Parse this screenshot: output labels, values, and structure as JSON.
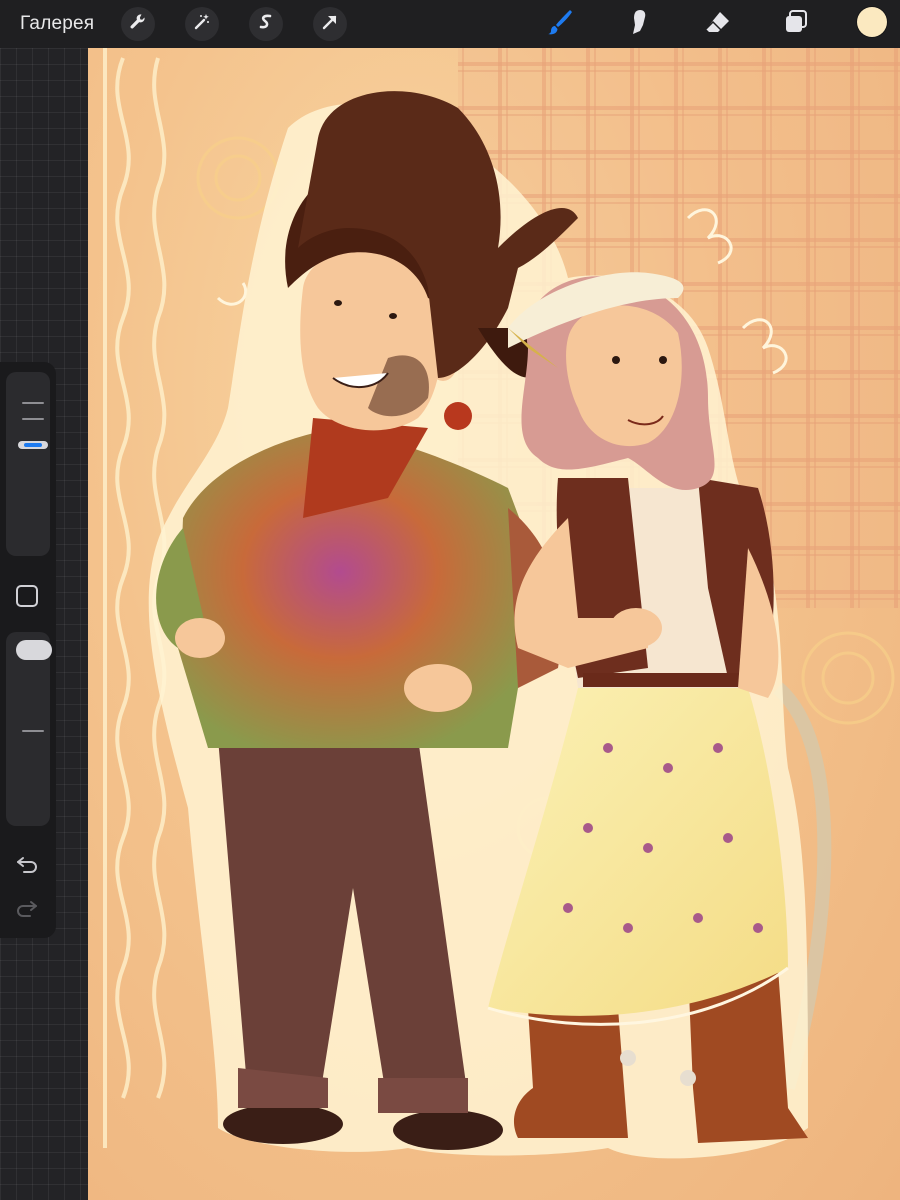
{
  "toolbar": {
    "gallery_label": "Галерея",
    "actions_icon": "wrench-icon",
    "adjustments_icon": "magic-wand-icon",
    "selection_icon": "selection-s-icon",
    "transform_icon": "arrow-cursor-icon",
    "brush_icon": "brush-icon",
    "smudge_icon": "smudge-finger-icon",
    "eraser_icon": "eraser-icon",
    "layers_icon": "layers-icon",
    "active_tool": "brush",
    "active_color": "#fbe9c0",
    "accent": "#1e7bf0"
  },
  "sidebar": {
    "brush_size_level": 0.62,
    "opacity_level": 1.0,
    "modify_icon": "square-modify-icon",
    "undo_icon": "undo-arrow-icon",
    "redo_icon": "redo-arrow-icon"
  },
  "canvas": {
    "artwork": "illustration-cowboy-couple",
    "colors": {
      "background": "#f4c38d",
      "plaid": "#e49a72",
      "hat": "#5a2a18",
      "shirt_green": "#8a9a4c",
      "shirt_magenta": "#b24b8f",
      "pants": "#6b4038",
      "skirt": "#f9eaa0",
      "boots": "#a04a22",
      "outline": "#fff4d6"
    }
  }
}
